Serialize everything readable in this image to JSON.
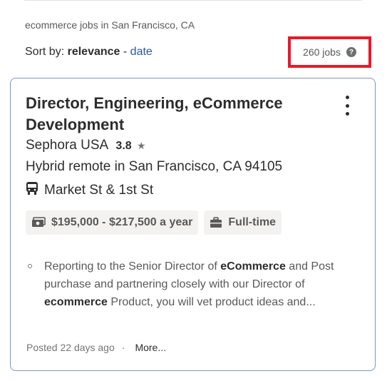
{
  "header": {
    "context": "ecommerce jobs in San Francisco, CA",
    "sort_prefix": "Sort by:",
    "sort_active": "relevance",
    "sort_sep": "-",
    "sort_alt": "date",
    "job_count": "260 jobs",
    "help_glyph": "?"
  },
  "job": {
    "title_line1": "Director, Engineering, eCommerce",
    "title_line2": "Development",
    "company": "Sephora USA",
    "rating": "3.8",
    "star": "★",
    "location": "Hybrid remote in San Francisco, CA 94105",
    "transit": "Market St & 1st St",
    "salary": "$195,000 - $217,500 a year",
    "job_type": "Full-time",
    "snippet": {
      "p1": "Reporting to the Senior Director of ",
      "b1": "eCommerce",
      "p2": " and Post purchase and partnering closely with our Director of ",
      "b2": "ecommerce",
      "p3": " Product, you will vet product ideas and..."
    },
    "posted": "Posted 22 days ago",
    "dot": "·",
    "more": "More..."
  },
  "colors": {
    "highlight_box": "#e8192c",
    "link": "#2557a7",
    "card_border": "#7a96c6"
  },
  "icons": [
    "help-icon",
    "kebab-menu-icon",
    "star-icon",
    "bus-icon",
    "money-icon",
    "briefcase-icon"
  ]
}
